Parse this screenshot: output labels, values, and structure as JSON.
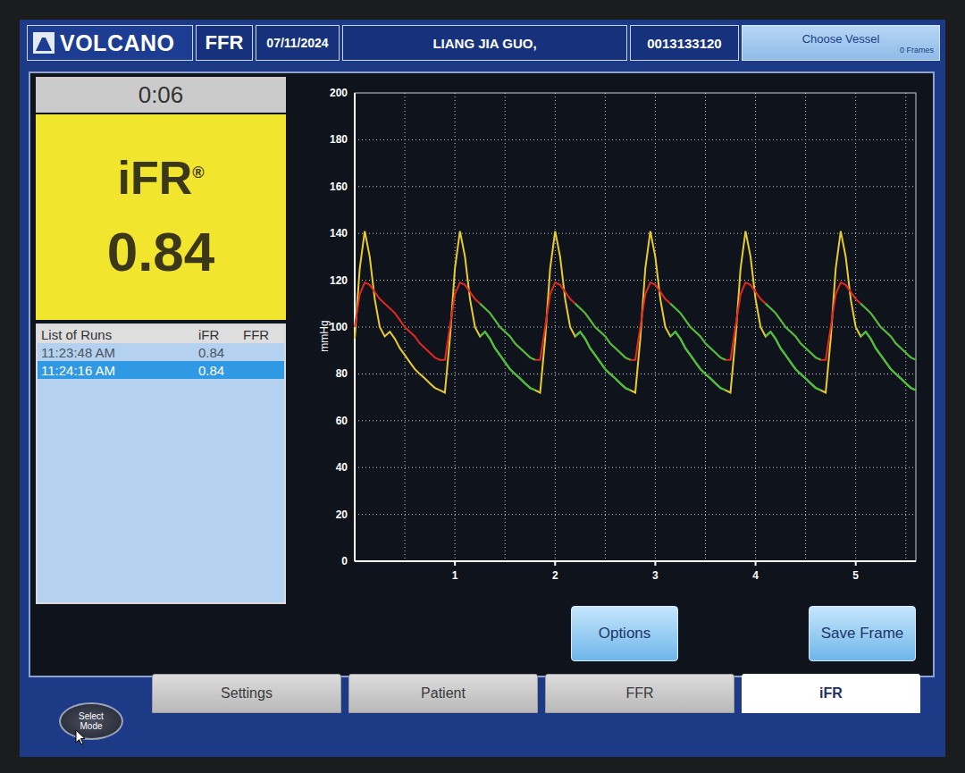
{
  "header": {
    "logo": "VOLCANO",
    "mode": "FFR",
    "date": "07/11/2024",
    "patient_name": "LIANG JIA GUO,",
    "patient_id": "0013133120",
    "vessel_button": "Choose Vessel",
    "frames": "0 Frames"
  },
  "timer": "0:06",
  "result": {
    "label": "iFR",
    "mark": "®",
    "value": "0.84"
  },
  "runs": {
    "columns": [
      "List of Runs",
      "iFR",
      "FFR"
    ],
    "rows": [
      {
        "time": "11:23:48 AM",
        "ifr": "0.84",
        "ffr": "",
        "selected": false
      },
      {
        "time": "11:24:16 AM",
        "ifr": "0.84",
        "ffr": "",
        "selected": true
      }
    ]
  },
  "chart": {
    "y_label": "mmHg",
    "y_ticks": [
      "0",
      "20",
      "40",
      "60",
      "80",
      "100",
      "120",
      "140",
      "160",
      "180",
      "200"
    ],
    "x_ticks": [
      "1",
      "2",
      "3",
      "4",
      "5"
    ],
    "sample_interval_s": 0.05,
    "series": [
      {
        "color": "#e8cc2e",
        "values": [
          95,
          125,
          141,
          130,
          112,
          100,
          96,
          98,
          95,
          91,
          88,
          85,
          82,
          80,
          78,
          76,
          74,
          73,
          72,
          95,
          125,
          141,
          130,
          112,
          100,
          96,
          98,
          95,
          91,
          88,
          85,
          82,
          80,
          78,
          76,
          74,
          73,
          72,
          95,
          125,
          141,
          130,
          112,
          100,
          96,
          98,
          95,
          91,
          88,
          85,
          82,
          80,
          78,
          76,
          74,
          73,
          72,
          95,
          125,
          141,
          130,
          112,
          100,
          96,
          98,
          95,
          91,
          88,
          85,
          82,
          80,
          78,
          76,
          74,
          73,
          72,
          95,
          125,
          141,
          130,
          112,
          100,
          96,
          98,
          95,
          91,
          88,
          85,
          82,
          80,
          78,
          76,
          74,
          73,
          72,
          95,
          125,
          141,
          130,
          112,
          100,
          96,
          98,
          95,
          91,
          88,
          85,
          82,
          80,
          78,
          76,
          74,
          73
        ]
      },
      {
        "color": "#e2281f",
        "values": [
          100,
          114,
          119,
          118,
          115,
          112,
          110,
          108,
          106,
          103,
          100,
          98,
          96,
          93,
          91,
          89,
          87,
          86,
          86,
          100,
          114,
          119,
          118,
          115,
          112,
          110,
          108,
          106,
          103,
          100,
          98,
          96,
          93,
          91,
          89,
          87,
          86,
          86,
          100,
          114,
          119,
          118,
          115,
          112,
          110,
          108,
          106,
          103,
          100,
          98,
          96,
          93,
          91,
          89,
          87,
          86,
          86,
          100,
          114,
          119,
          118,
          115,
          112,
          110,
          108,
          106,
          103,
          100,
          98,
          96,
          93,
          91,
          89,
          87,
          86,
          86,
          100,
          114,
          119,
          118,
          115,
          112,
          110,
          108,
          106,
          103,
          100,
          98,
          96,
          93,
          91,
          89,
          87,
          86,
          86,
          100,
          114,
          119,
          118,
          115,
          112,
          110,
          108,
          106,
          103,
          100,
          98,
          96,
          93,
          91,
          89,
          87,
          86
        ]
      }
    ],
    "wave_free_color": "#3ec43e",
    "wave_free_windows": [
      {
        "start": 1.25,
        "end": 1.8
      },
      {
        "start": 2.2,
        "end": 2.75
      },
      {
        "start": 3.15,
        "end": 3.7
      },
      {
        "start": 4.1,
        "end": 4.65
      },
      {
        "start": 5.05,
        "end": 5.6
      }
    ]
  },
  "buttons": [
    {
      "label": "Options"
    },
    {
      "label": "Save Frame"
    }
  ],
  "tabs": [
    {
      "label": "Settings",
      "selected": false
    },
    {
      "label": "Patient",
      "selected": false
    },
    {
      "label": "FFR",
      "selected": false
    },
    {
      "label": "iFR",
      "selected": true
    }
  ],
  "select_mode": "Select Mode"
}
